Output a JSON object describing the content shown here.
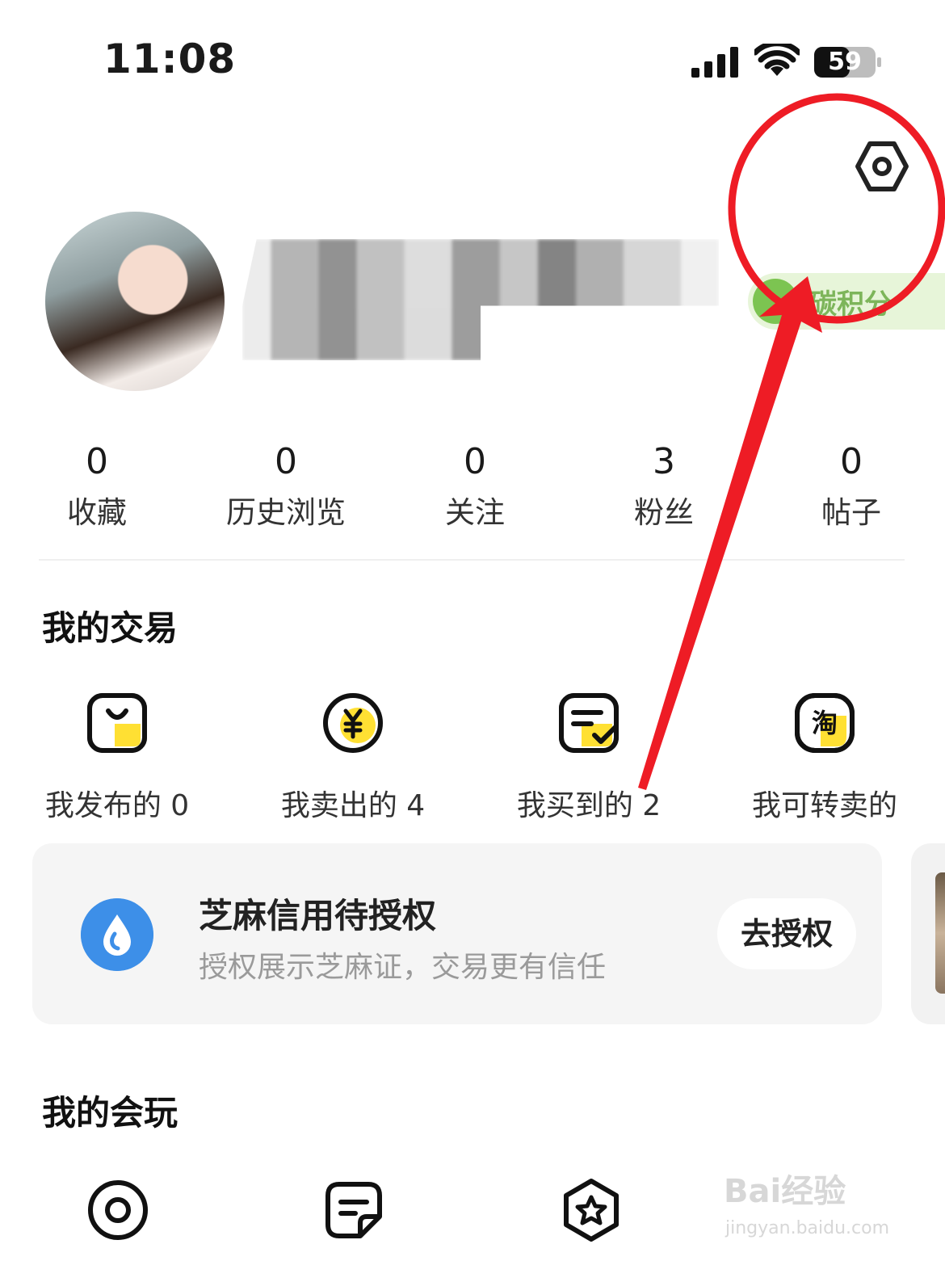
{
  "status_bar": {
    "time": "11:08",
    "battery": "59"
  },
  "profile": {
    "carbon_label": "碳积分"
  },
  "stats": [
    {
      "value": "0",
      "label": "收藏"
    },
    {
      "value": "0",
      "label": "历史浏览"
    },
    {
      "value": "0",
      "label": "关注"
    },
    {
      "value": "3",
      "label": "粉丝"
    },
    {
      "value": "0",
      "label": "帖子"
    }
  ],
  "trade": {
    "title": "我的交易",
    "items": [
      {
        "label": "我发布的 0",
        "icon": "bag-icon"
      },
      {
        "label": "我卖出的 4",
        "icon": "yen-icon"
      },
      {
        "label": "我买到的 2",
        "icon": "order-check-icon"
      },
      {
        "label": "我可转卖的",
        "icon": "taobao-icon"
      }
    ]
  },
  "zhima": {
    "title": "芝麻信用待授权",
    "subtitle": "授权展示芝麻证，交易更有信任",
    "button": "去授权"
  },
  "play": {
    "title": "我的会玩"
  },
  "watermark": {
    "main": "Bai经验",
    "sub": "jingyan.baidu.com"
  },
  "colors": {
    "accent_yellow": "#ffe033",
    "annotation_red": "#ee1c25",
    "zhima_blue": "#3d8fe8"
  }
}
